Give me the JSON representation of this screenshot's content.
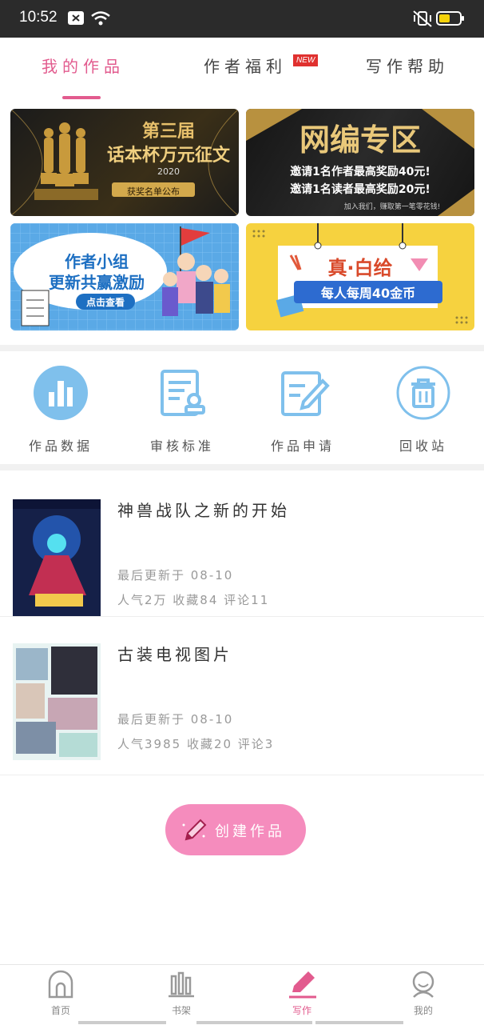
{
  "status": {
    "time": "10:52"
  },
  "tabs": [
    {
      "label": "我的作品",
      "active": true
    },
    {
      "label": "作者福利",
      "badge": "NEW"
    },
    {
      "label": "写作帮助"
    }
  ],
  "banners": {
    "b1": {
      "line1": "第三届",
      "line2": "话本杯万元征文",
      "year": "2020",
      "button": "获奖名单公布"
    },
    "b2": {
      "title": "网编专区",
      "line1": "邀请1名作者最高奖励40元!",
      "line2": "邀请1名读者最高奖励20元!",
      "foot": "加入我们，赚取第一笔零花钱!"
    },
    "b3": {
      "line1": "作者小组",
      "line2": "更新共赢激励",
      "button": "点击查看"
    },
    "b4": {
      "line1": "真·白给",
      "line2": "每人每周40金币"
    }
  },
  "quick": [
    {
      "label": "作品数据",
      "icon": "bar-chart-icon"
    },
    {
      "label": "审核标准",
      "icon": "document-stamp-icon"
    },
    {
      "label": "作品申请",
      "icon": "edit-document-icon"
    },
    {
      "label": "回收站",
      "icon": "trash-icon"
    }
  ],
  "works": [
    {
      "title": "神兽战队之新的开始",
      "updated": "最后更新于 08-10",
      "stats": "人气2万 收藏84 评论11"
    },
    {
      "title": "古装电视图片",
      "updated": "最后更新于 08-10",
      "stats": "人气3985 收藏20 评论3"
    }
  ],
  "create_button": "创建作品",
  "bottom_nav": [
    {
      "label": "首页",
      "icon": "home-icon"
    },
    {
      "label": "书架",
      "icon": "bookshelf-icon"
    },
    {
      "label": "写作",
      "icon": "pen-icon",
      "active": true
    },
    {
      "label": "我的",
      "icon": "profile-icon"
    }
  ],
  "colors": {
    "accent": "#e25b8e",
    "create_bg": "#f58cbd",
    "icon_blue": "#7fc0ec"
  }
}
